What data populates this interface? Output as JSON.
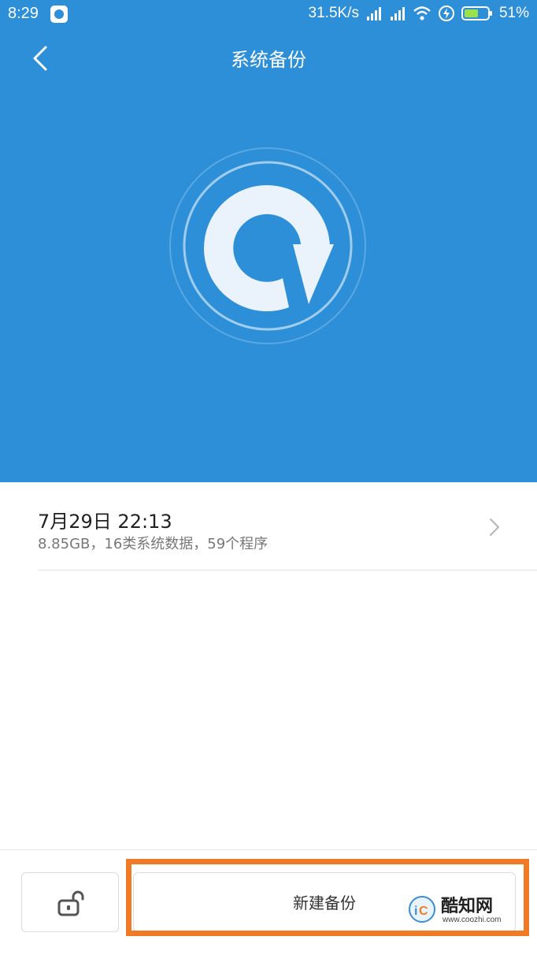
{
  "status_bar": {
    "time": "8:29",
    "speed": "31.5K/s",
    "battery": "51%",
    "icons": [
      "app-icon",
      "signal-hd-icon",
      "signal-icon",
      "wifi-icon",
      "charging-icon",
      "battery-icon"
    ]
  },
  "header": {
    "title": "系统备份",
    "back_icon": "chevron-left-icon"
  },
  "backup_list": [
    {
      "date": "7月29日 22:13",
      "detail": "8.85GB，16类系统数据，59个程序"
    }
  ],
  "bottom_bar": {
    "lock_icon": "unlock-icon",
    "new_backup_label": "新建备份"
  },
  "watermark": {
    "title": "酷知网",
    "url": "www.coozhi.com"
  },
  "colors": {
    "primary": "#2d8fd8",
    "highlight": "#f07a26"
  }
}
